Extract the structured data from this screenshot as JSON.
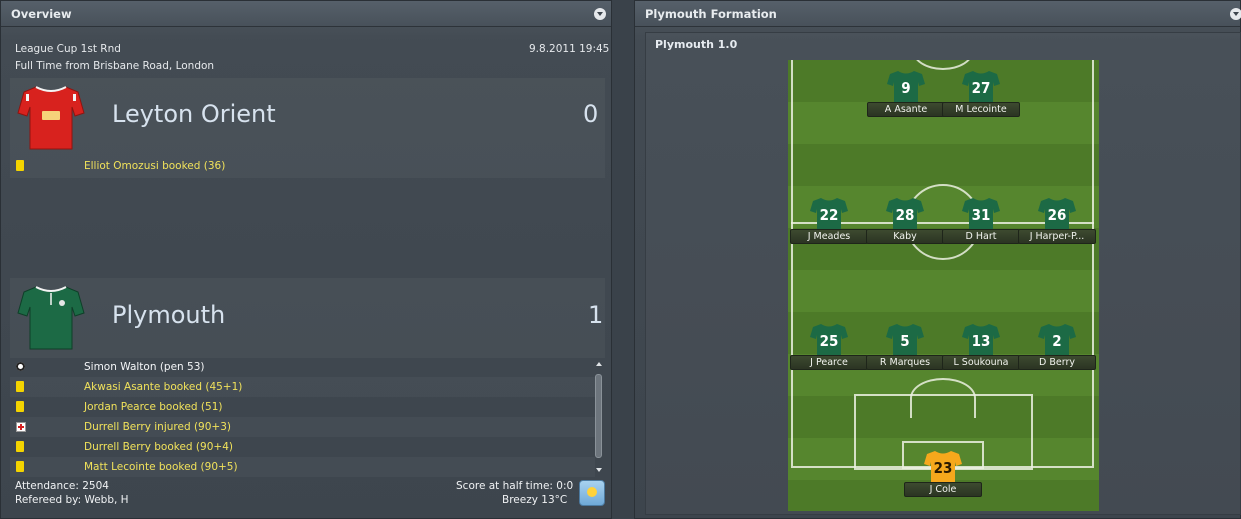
{
  "overview": {
    "title": "Overview",
    "competition": "League Cup 1st Rnd",
    "venue": "Full Time from Brisbane Road, London",
    "datetime": "9.8.2011 19:45",
    "home": {
      "name": "Leyton Orient",
      "score": "0",
      "shirt_color": "#d8221e",
      "events": [
        {
          "icon": "yellow-card-icon",
          "text": "Elliot Omozusi booked (36)",
          "style": "yellow"
        }
      ]
    },
    "away": {
      "name": "Plymouth",
      "score": "1",
      "shirt_color": "#1c6a45",
      "events": [
        {
          "icon": "goal-ball-icon",
          "text": "Simon Walton (pen 53)",
          "style": "white"
        },
        {
          "icon": "yellow-card-icon",
          "text": "Akwasi Asante booked (45+1)",
          "style": "yellow"
        },
        {
          "icon": "yellow-card-icon",
          "text": "Jordan Pearce booked (51)",
          "style": "yellow"
        },
        {
          "icon": "injury-icon",
          "text": "Durrell Berry injured (90+3)",
          "style": "yellow"
        },
        {
          "icon": "yellow-card-icon",
          "text": "Durrell Berry booked (90+4)",
          "style": "yellow"
        },
        {
          "icon": "yellow-card-icon",
          "text": "Matt Lecointe booked (90+5)",
          "style": "yellow"
        }
      ]
    },
    "attendance": "Attendance: 2504",
    "referee": "Refereed by: Webb, H",
    "half_time": "Score at half time: 0:0",
    "weather": "Breezy 13°C",
    "weather_icon": "sunny-weather-icon"
  },
  "formation_panel": {
    "title": "Plymouth Formation",
    "formation_name": "Plymouth 1.0",
    "players": [
      {
        "number": "9",
        "name": "A Asante",
        "role": "forward"
      },
      {
        "number": "27",
        "name": "M Lecointe",
        "role": "forward"
      },
      {
        "number": "22",
        "name": "J Meades",
        "role": "midfield"
      },
      {
        "number": "28",
        "name": "Kaby",
        "role": "midfield"
      },
      {
        "number": "31",
        "name": "D Hart",
        "role": "midfield"
      },
      {
        "number": "26",
        "name": "J Harper-P...",
        "role": "midfield"
      },
      {
        "number": "25",
        "name": "J Pearce",
        "role": "defence"
      },
      {
        "number": "5",
        "name": "R Marques",
        "role": "defence"
      },
      {
        "number": "13",
        "name": "L Soukouna",
        "role": "defence"
      },
      {
        "number": "2",
        "name": "D Berry",
        "role": "defence"
      },
      {
        "number": "23",
        "name": "J Cole",
        "role": "goalkeeper"
      }
    ],
    "outfield_shirt_color": "#1c6a45",
    "keeper_shirt_color": "#f5a81c"
  }
}
